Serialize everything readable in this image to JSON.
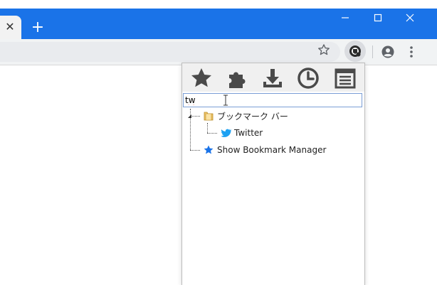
{
  "titlebar": {
    "tab_close_glyph": "✕",
    "new_tab_glyph": "+",
    "minimize_glyph": "—",
    "maximize_glyph": "☐",
    "close_glyph": "✕"
  },
  "colors": {
    "titlebar": "#1a73e8",
    "twitter": "#1da1f2",
    "bookmark_manager_star": "#1a73e8",
    "folder": "#e8b64a"
  },
  "popup": {
    "tools": [
      {
        "name": "bookmarks-star-icon"
      },
      {
        "name": "extensions-puzzle-icon"
      },
      {
        "name": "downloads-icon"
      },
      {
        "name": "history-clock-icon"
      },
      {
        "name": "notes-list-icon"
      }
    ],
    "search": {
      "value": "tw"
    },
    "tree": {
      "folder_label": "ブックマーク バー",
      "twitter_label": "Twitter",
      "manager_label": "Show Bookmark Manager"
    }
  }
}
